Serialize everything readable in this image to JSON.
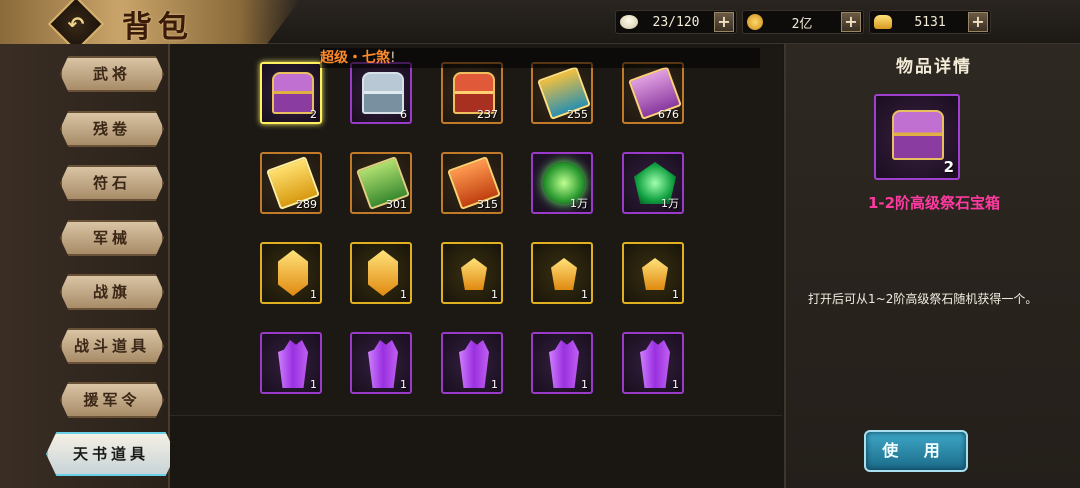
{
  "header": {
    "title": "背包",
    "back_glyph": "↶",
    "resources": [
      {
        "name": "stamina",
        "icon": "steamed-bun-icon",
        "value": "23/120"
      },
      {
        "name": "coins",
        "icon": "gold-coin-icon",
        "value": "2亿"
      },
      {
        "name": "ingots",
        "icon": "gold-ingot-icon",
        "value": "5131"
      }
    ],
    "plus_glyph": "+"
  },
  "sidebar": {
    "tabs": [
      "武将",
      "残卷",
      "符石",
      "军械",
      "战旗",
      "战斗道具",
      "援军令",
      "天书道具"
    ],
    "active_index": 7
  },
  "marquee": {
    "highlight": "超级・七煞",
    "rest": "!"
  },
  "grid": {
    "rows": [
      [
        {
          "icon": "purple-chest-icon",
          "count": "2",
          "rarity": "purple",
          "selected": true
        },
        {
          "icon": "silver-chest-icon",
          "count": "6",
          "rarity": "purple"
        },
        {
          "icon": "red-chest-icon",
          "count": "237",
          "rarity": "orange"
        },
        {
          "icon": "teal-book-icon",
          "count": "255",
          "rarity": "orange"
        },
        {
          "icon": "purple-book-icon",
          "count": "676",
          "rarity": "orange"
        }
      ],
      [
        {
          "icon": "yellow-book-icon",
          "count": "289",
          "rarity": "orange"
        },
        {
          "icon": "green-book-icon",
          "count": "301",
          "rarity": "orange"
        },
        {
          "icon": "orange-book-icon",
          "count": "315",
          "rarity": "orange"
        },
        {
          "icon": "green-orb-icon",
          "count": "1万",
          "rarity": "purple"
        },
        {
          "icon": "green-gem-icon",
          "count": "1万",
          "rarity": "purple"
        }
      ],
      [
        {
          "icon": "gold-rune-stone-icon",
          "count": "1",
          "rarity": "gold"
        },
        {
          "icon": "gold-rune-stone-icon",
          "count": "1",
          "rarity": "gold"
        },
        {
          "icon": "gold-rune-stone-small-icon",
          "count": "1",
          "rarity": "gold"
        },
        {
          "icon": "gold-rune-stone-small-icon",
          "count": "1",
          "rarity": "gold"
        },
        {
          "icon": "gold-rune-stone-small-icon",
          "count": "1",
          "rarity": "gold"
        }
      ],
      [
        {
          "icon": "purple-crystal-icon",
          "count": "1",
          "rarity": "purple"
        },
        {
          "icon": "purple-crystal-icon",
          "count": "1",
          "rarity": "purple"
        },
        {
          "icon": "purple-crystal-icon",
          "count": "1",
          "rarity": "purple"
        },
        {
          "icon": "purple-crystal-icon",
          "count": "1",
          "rarity": "purple"
        },
        {
          "icon": "purple-crystal-icon",
          "count": "1",
          "rarity": "purple"
        }
      ]
    ]
  },
  "detail": {
    "heading": "物品详情",
    "icon": "purple-chest-icon",
    "count": "2",
    "item_name": "1-2阶高级祭石宝箱",
    "description": "打开后可从1~2阶高级祭石随机获得一个。",
    "use_button": "使 用"
  },
  "colors": {
    "orange_border": "#c07a2a",
    "purple_border": "#9a3ac8",
    "gold_border": "#e0b020",
    "item_name": "#ff3aa0",
    "marquee": "#ff8a2a"
  }
}
